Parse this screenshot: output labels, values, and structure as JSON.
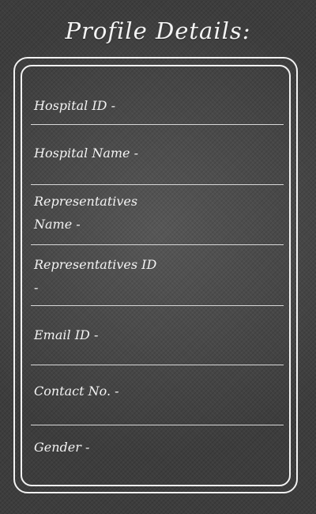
{
  "header": {
    "title": "Profile Details:"
  },
  "fields": [
    {
      "label": "Hospital ID -"
    },
    {
      "label": "Hospital Name -"
    },
    {
      "label": "Representatives Name -"
    },
    {
      "label": "Representatives ID -"
    },
    {
      "label": "Email ID -"
    },
    {
      "label": "Contact No. -"
    },
    {
      "label": "Gender -"
    }
  ],
  "colors": {
    "background": "#4a4a4a",
    "text": "#f3f3f3",
    "border": "#f2f2f2"
  }
}
